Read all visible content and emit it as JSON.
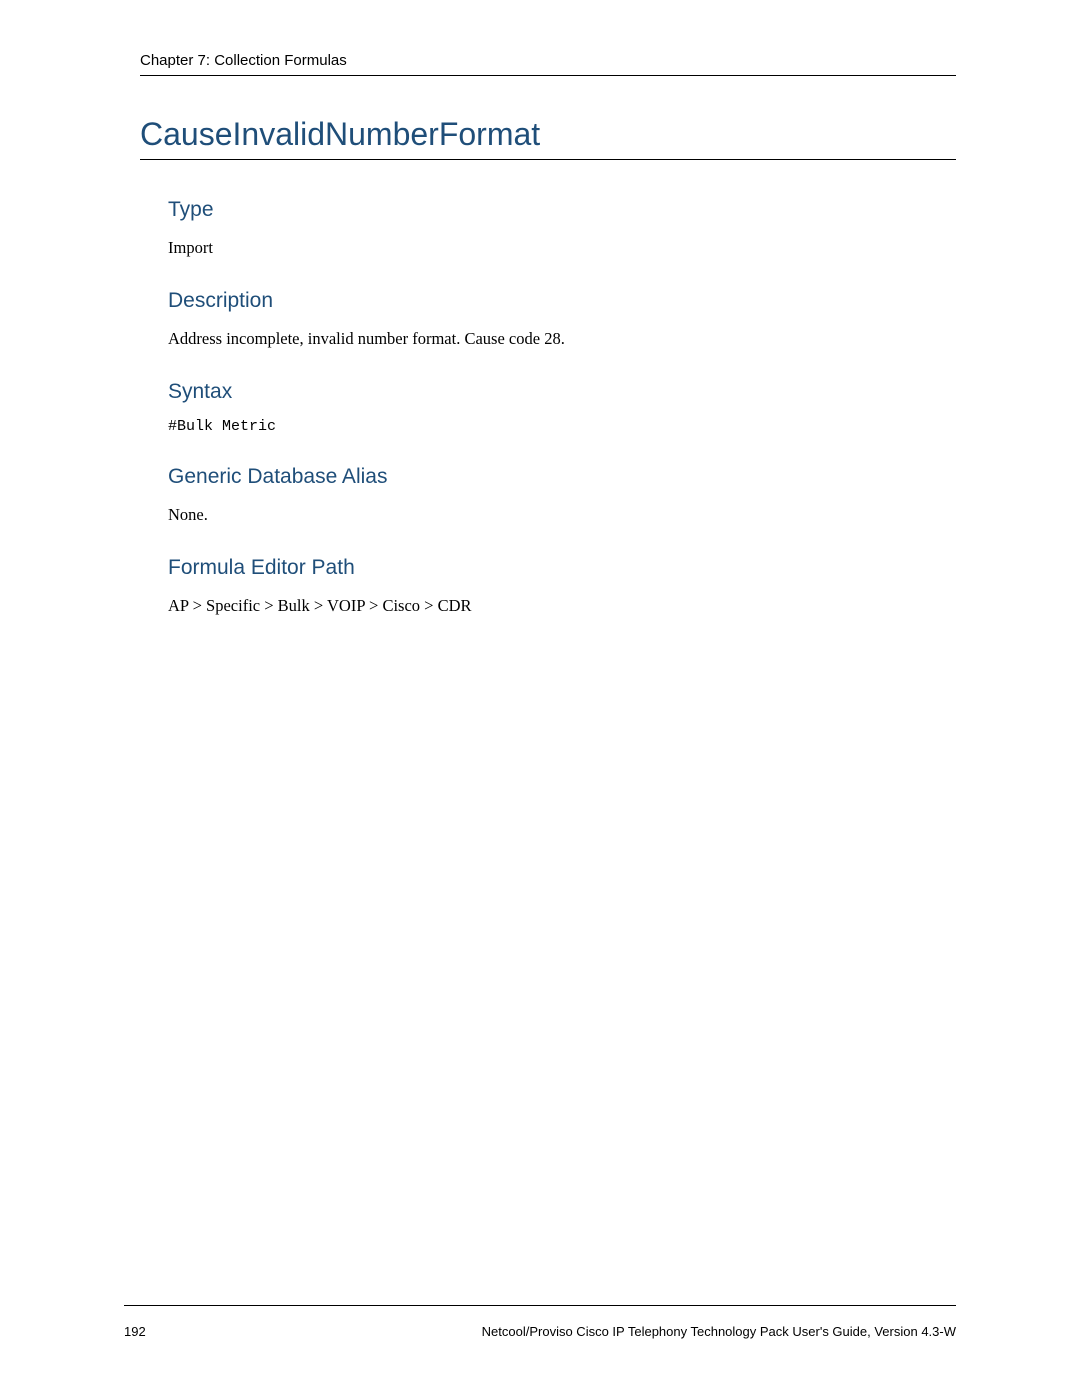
{
  "header": {
    "chapter": "Chapter 7: Collection Formulas"
  },
  "title": "CauseInvalidNumberFormat",
  "sections": {
    "type": {
      "heading": "Type",
      "body": "Import"
    },
    "description": {
      "heading": "Description",
      "body": "Address incomplete, invalid number format. Cause code 28."
    },
    "syntax": {
      "heading": "Syntax",
      "body": "#Bulk Metric"
    },
    "alias": {
      "heading": "Generic Database Alias",
      "body": "None."
    },
    "path": {
      "heading": "Formula Editor Path",
      "body": "AP > Specific > Bulk > VOIP > Cisco > CDR"
    }
  },
  "footer": {
    "page_number": "192",
    "doc_title": "Netcool/Proviso Cisco IP Telephony Technology Pack User's Guide, Version 4.3-W"
  }
}
